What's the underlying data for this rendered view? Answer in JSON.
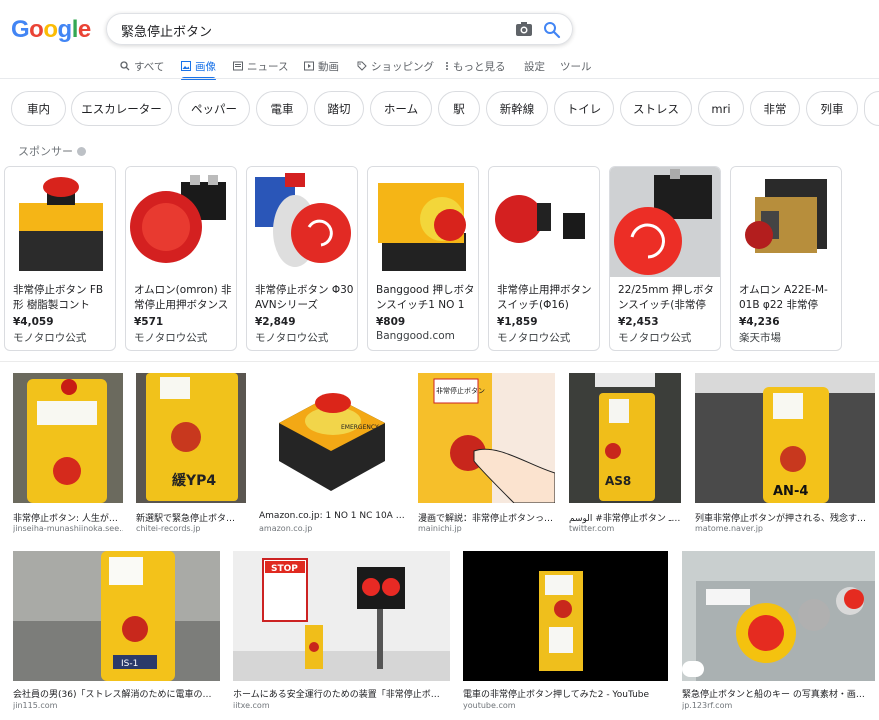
{
  "logo": {
    "letters": [
      "G",
      "o",
      "o",
      "g",
      "l",
      "e"
    ],
    "colors": [
      "#4285f4",
      "#ea4335",
      "#fbbc05",
      "#4285f4",
      "#34a853",
      "#ea4335"
    ]
  },
  "search": {
    "value": "緊急停止ボタン"
  },
  "tabs": [
    {
      "label": "すべて",
      "icon": "search-icon",
      "active": false
    },
    {
      "label": "画像",
      "icon": "image-icon",
      "active": true
    },
    {
      "label": "ニュース",
      "icon": "news-icon",
      "active": false
    },
    {
      "label": "動画",
      "icon": "video-icon",
      "active": false
    },
    {
      "label": "ショッピング",
      "icon": "tag-icon",
      "active": false
    },
    {
      "label": "もっと見る",
      "icon": "more-vert-icon",
      "active": false
    },
    {
      "label": "設定",
      "icon": "",
      "active": false
    },
    {
      "label": "ツール",
      "icon": "",
      "active": false
    }
  ],
  "chips": [
    "車内",
    "エスカレーター",
    "ペッパー",
    "電車",
    "踏切",
    "ホーム",
    "駅",
    "新幹線",
    "トイレ",
    "ストレス",
    "mri",
    "非常",
    "列車"
  ],
  "sponsored": {
    "label": "スポンサー",
    "products": [
      {
        "title": "非常停止ボタン FB形 樹脂製コント",
        "price": "¥4,059",
        "store": "モノタロウ公式"
      },
      {
        "title": "オムロン(omron) 非常停止用押ボタンス",
        "price": "¥571",
        "store": "モノタロウ公式"
      },
      {
        "title": "非常停止ボタン Φ30 AVNシリーズ",
        "price": "¥2,849",
        "store": "モノタロウ公式"
      },
      {
        "title": "Banggood 押しボタンスイッチ1 NO 1",
        "price": "¥809",
        "store": "Banggood.com"
      },
      {
        "title": "非常停止用押ボタンスイッチ(Φ16)",
        "price": "¥1,859",
        "store": "モノタロウ公式"
      },
      {
        "title": "22/25mm 押しボタンスイッチ(非常停",
        "price": "¥2,453",
        "store": "モノタロウ公式"
      },
      {
        "title": "オムロン A22E-M-01B φ22 非常停",
        "price": "¥4,236",
        "store": "楽天市場"
      }
    ]
  },
  "images_row1": [
    {
      "title": "非常停止ボタン: 人生が…",
      "source": "jinseiha-munashiinoka.see…"
    },
    {
      "title": "新選駅で緊急停止ボタ…",
      "source": "chitei-records.jp"
    },
    {
      "title": "Amazon.co.jp: 1 NO 1 NC 10A 6…",
      "source": "amazon.co.jp"
    },
    {
      "title": "漫画で解説：非常停止ボタンっ…",
      "source": "mainichi.jp"
    },
    {
      "title": "الوسم #非常停止ボタン على تـ…",
      "source": "twitter.com"
    },
    {
      "title": "列車非常停止ボタンが押される、残念す…",
      "source": "matome.naver.jp"
    }
  ],
  "images_row2": [
    {
      "title": "会社員の男(36)「ストレス解消のために電車の…",
      "source": "jin115.com"
    },
    {
      "title": "ホームにある安全運行のための装置「非常停止ボ…",
      "source": "iitxe.com"
    },
    {
      "title": "電車の非常停止ボタン押してみた2 - YouTube",
      "source": "youtube.com"
    },
    {
      "title": "緊急停止ボタンと船のキー の写真素材・画…",
      "source": "jp.123rf.com"
    }
  ],
  "image_labels": {
    "yp4": "緩YP4",
    "as8": "AS8",
    "an4": "AN-4",
    "is1": "IS-1",
    "stop": "STOP",
    "emergency": "EMERGENCY",
    "hijo": "非常停止ボタン"
  }
}
